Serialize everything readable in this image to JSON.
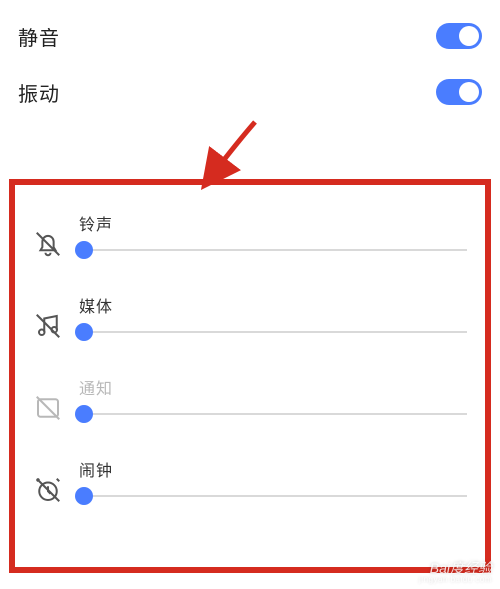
{
  "toggles": {
    "mute": {
      "label": "静音",
      "on": true
    },
    "vibrate": {
      "label": "振动",
      "on": true
    }
  },
  "sliders": {
    "ringtone": {
      "label": "铃声",
      "value": 0,
      "disabled": false
    },
    "media": {
      "label": "媒体",
      "value": 0,
      "disabled": false
    },
    "notify": {
      "label": "通知",
      "value": 0,
      "disabled": true
    },
    "alarm": {
      "label": "闹钟",
      "value": 0,
      "disabled": false
    }
  },
  "watermark": {
    "brand": "Bai度经验",
    "sub": "jingyan.baidu.com"
  }
}
